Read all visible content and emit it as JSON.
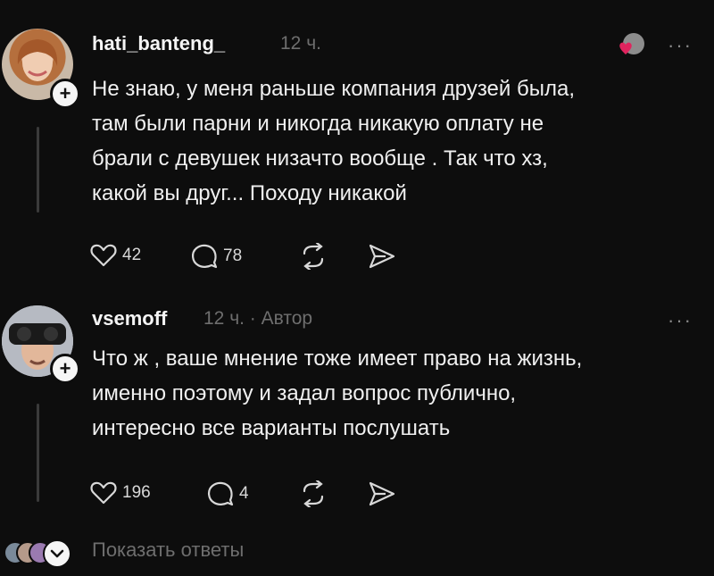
{
  "comments": [
    {
      "username": "hati_banteng_",
      "time": "12 ч.",
      "text": "Не знаю, у меня раньше компания друзей была,\nтам были парни и никогда никакую оплату не\nбрали с девушек низачто вообще . Так что хз,\nкакой вы друг... Походу никакой",
      "likes": "42",
      "comments": "78"
    },
    {
      "username": "vsemoff",
      "time": "12 ч. · Автор",
      "text": "Что ж , ваше мнение тоже имеет право на жизнь,\nименно поэтому и задал вопрос публично,\nинтересно все варианты послушать",
      "likes": "196",
      "comments": "4"
    }
  ],
  "show_replies": "Показать ответы",
  "more_label": "···",
  "colors": {
    "background": "#0d0d0d",
    "text": "#f0f0f0",
    "muted": "#6e6e6e",
    "heart": "#e0245e"
  },
  "icons": [
    "plus-icon",
    "heart-icon",
    "comment-icon",
    "repost-icon",
    "share-icon",
    "more-icon",
    "chevron-down-icon"
  ]
}
